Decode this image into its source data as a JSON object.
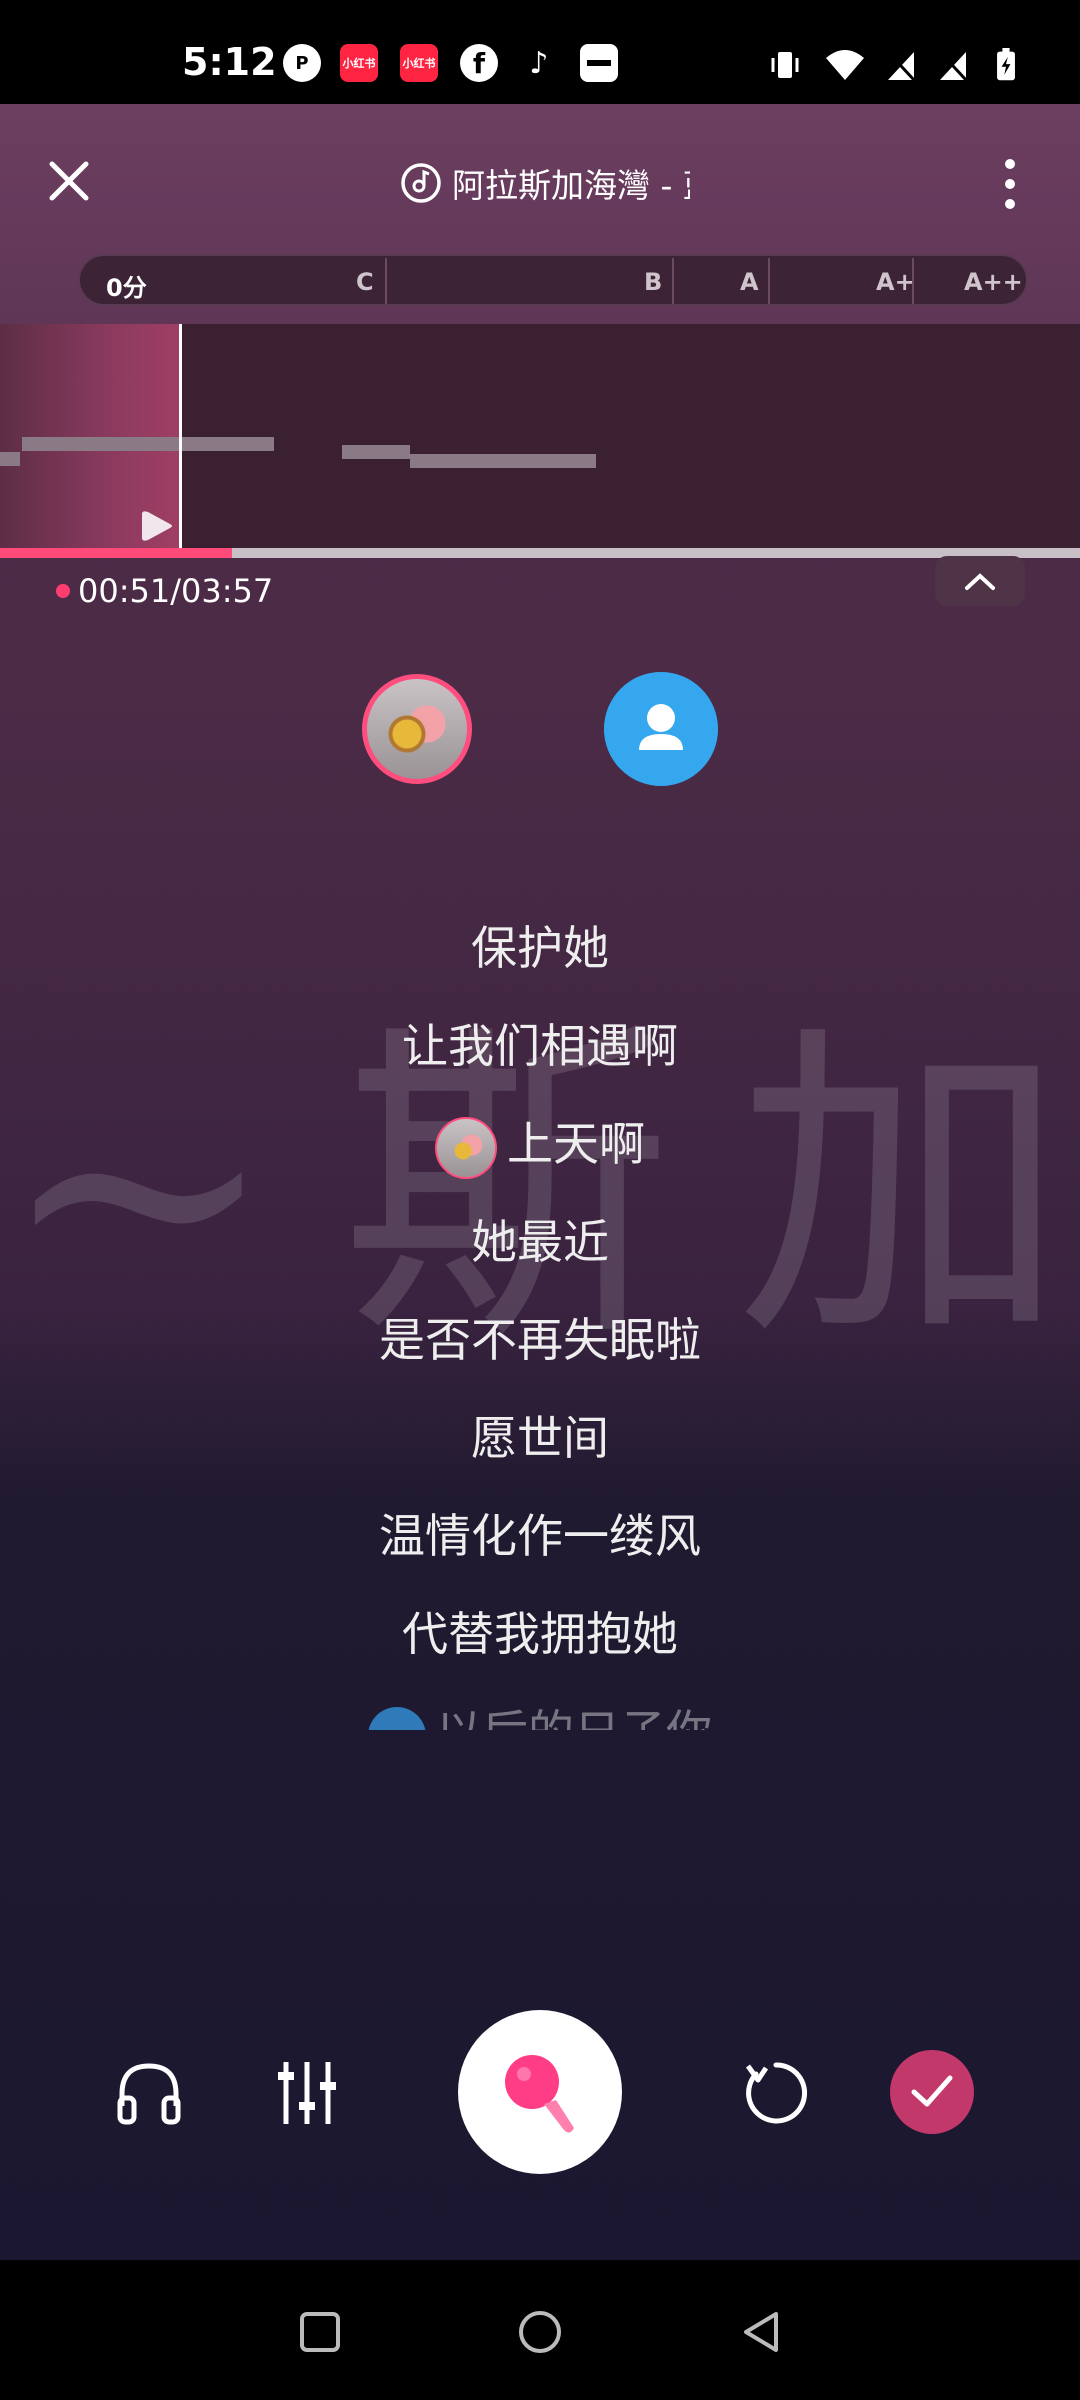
{
  "status_bar": {
    "time": "5:12",
    "app_icons": [
      "p-icon",
      "xiaohongshu-icon",
      "xiaohongshu-icon",
      "facebook-icon",
      "tiktok-icon",
      "wallet-icon"
    ],
    "xiaohongshu_label": "小红书"
  },
  "header": {
    "song_title": "阿拉斯加海灣 - 蓝",
    "close_icon": "close-icon",
    "more_icon": "more-vertical-icon"
  },
  "score": {
    "current": "0分",
    "grades": [
      "C",
      "B",
      "A",
      "A+",
      "A++"
    ]
  },
  "playback": {
    "time": "00:51/03:57",
    "progress_fraction": 0.215
  },
  "lyrics": {
    "lines": [
      "保护她",
      "让我们相遇啊",
      "上天啊",
      "她最近",
      "是否不再失眠啦",
      "愿世间",
      "温情化作一缕风",
      "代替我拥抱她",
      "以后的日子你"
    ],
    "active_index": 2
  },
  "controls": {
    "headphones_icon": "headphones-icon",
    "mixer_icon": "mixer-icon",
    "record_icon": "microphone-icon",
    "retry_icon": "retry-icon",
    "done_icon": "check-icon"
  },
  "colors": {
    "accent": "#ff4a7a",
    "done": "#c2386a",
    "partner": "#35a7ee"
  }
}
